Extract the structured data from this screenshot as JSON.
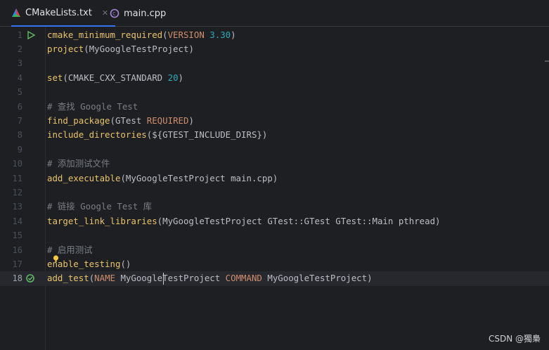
{
  "tabs": [
    {
      "label": "CMakeLists.txt",
      "icon": "cmake-icon",
      "active": true,
      "close": "✕"
    },
    {
      "label": "main.cpp",
      "icon": "cpp-file-icon",
      "active": false
    }
  ],
  "editor": {
    "current_line": 18,
    "lines": [
      {
        "n": "1",
        "seg": [
          [
            "fn",
            "cmake_minimum_required"
          ],
          [
            "paren",
            "("
          ],
          [
            "kw",
            "VERSION "
          ],
          [
            "num",
            "3.30"
          ],
          [
            "paren",
            ")"
          ]
        ]
      },
      {
        "n": "2",
        "seg": [
          [
            "fn",
            "project"
          ],
          [
            "paren",
            "("
          ],
          [
            "plain",
            "MyGoogleTestProject"
          ],
          [
            "paren",
            ")"
          ]
        ]
      },
      {
        "n": "3",
        "seg": []
      },
      {
        "n": "4",
        "seg": [
          [
            "fn",
            "set"
          ],
          [
            "paren",
            "("
          ],
          [
            "plain",
            "CMAKE_CXX_STANDARD "
          ],
          [
            "num",
            "20"
          ],
          [
            "paren",
            ")"
          ]
        ]
      },
      {
        "n": "5",
        "seg": []
      },
      {
        "n": "6",
        "seg": [
          [
            "cmt",
            "# 查找 Google Test"
          ]
        ]
      },
      {
        "n": "7",
        "seg": [
          [
            "fn",
            "find_package"
          ],
          [
            "paren",
            "("
          ],
          [
            "plain",
            "GTest "
          ],
          [
            "kw",
            "REQUIRED"
          ],
          [
            "paren",
            ")"
          ]
        ]
      },
      {
        "n": "8",
        "seg": [
          [
            "fn",
            "include_directories"
          ],
          [
            "paren",
            "("
          ],
          [
            "plain",
            "${GTEST_INCLUDE_DIRS}"
          ],
          [
            "paren",
            ")"
          ]
        ]
      },
      {
        "n": "9",
        "seg": []
      },
      {
        "n": "10",
        "seg": [
          [
            "cmt",
            "# 添加测试文件"
          ]
        ]
      },
      {
        "n": "11",
        "seg": [
          [
            "fn",
            "add_executable"
          ],
          [
            "paren",
            "("
          ],
          [
            "plain",
            "MyGoogleTestProject main.cpp"
          ],
          [
            "paren",
            ")"
          ]
        ]
      },
      {
        "n": "12",
        "seg": []
      },
      {
        "n": "13",
        "seg": [
          [
            "cmt",
            "# 链接 Google Test 库"
          ]
        ]
      },
      {
        "n": "14",
        "seg": [
          [
            "fn",
            "target_link_libraries"
          ],
          [
            "paren",
            "("
          ],
          [
            "plain",
            "MyGoogleTestProject GTest::GTest GTest::Main pthread"
          ],
          [
            "paren",
            ")"
          ]
        ]
      },
      {
        "n": "15",
        "seg": []
      },
      {
        "n": "16",
        "seg": [
          [
            "cmt",
            "# 启用测试"
          ]
        ]
      },
      {
        "n": "17",
        "seg": [
          [
            "fn",
            "enable_testing"
          ],
          [
            "paren",
            "()"
          ]
        ]
      },
      {
        "n": "18",
        "seg": [
          [
            "fn",
            "add_test"
          ],
          [
            "paren",
            "("
          ],
          [
            "kw",
            "NAME "
          ],
          [
            "plain",
            "MyGoogleTestProject "
          ],
          [
            "kw",
            "COMMAND "
          ],
          [
            "plain",
            "MyGoogleTestProject"
          ],
          [
            "paren",
            ")"
          ]
        ]
      }
    ]
  },
  "watermark": "CSDN @獨梟",
  "colors": {
    "accent": "#3574f0",
    "function": "#e8c46b",
    "keyword": "#cf8e6d",
    "number": "#2aacb8",
    "comment": "#7a7e85"
  }
}
